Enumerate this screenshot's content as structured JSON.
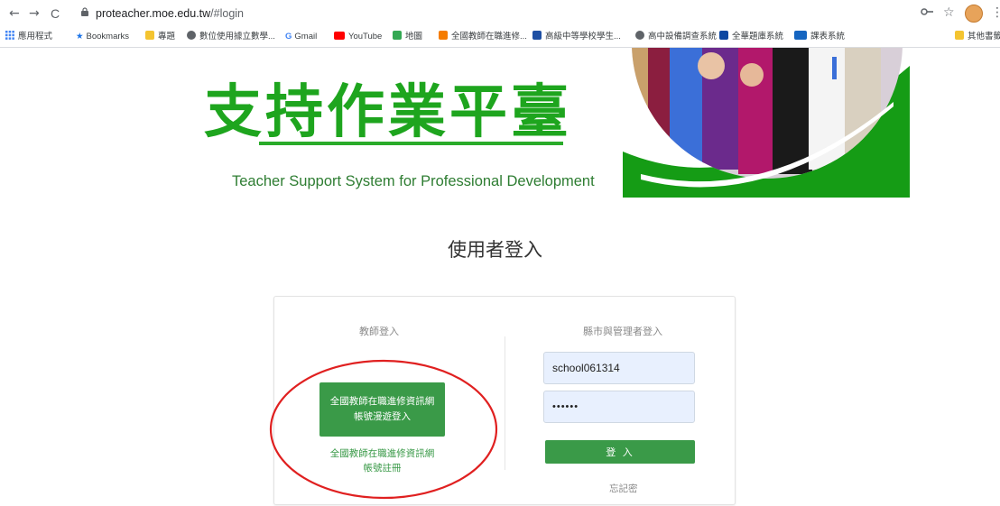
{
  "browser": {
    "back": "←",
    "forward": "→",
    "reload": "C",
    "url_host": "proteacher.moe.edu.tw",
    "url_path": "/#login"
  },
  "bookmarks": {
    "apps": "應用程式",
    "items": [
      "Bookmarks",
      "專題",
      "數位使用據立數學...",
      "Gmail",
      "YouTube",
      "地圖",
      "全國教師在職進修...",
      "高級中等學校學生...",
      "高中設備調查系統",
      "全華題庫系統",
      "課表系統"
    ],
    "other": "其他書籤"
  },
  "header": {
    "title": "支持作業平臺",
    "subtitle": "Teacher Support System for  Professional Development"
  },
  "login": {
    "title": "使用者登入",
    "teacher_head": "教師登入",
    "admin_head": "縣市與管理者登入",
    "moe_login_line1": "全國教師在職進修資訊網",
    "moe_login_line2": "帳號漫遊登入",
    "register_line1": "全國教師在職進修資訊網",
    "register_line2": "帳號註冊",
    "username": "school061314",
    "password": "••••••",
    "submit": "登 入",
    "forgot": "忘記密"
  },
  "colors": {
    "brand_green": "#1ea51e",
    "button_green": "#3a9a48",
    "annotation_red": "#e02020"
  }
}
